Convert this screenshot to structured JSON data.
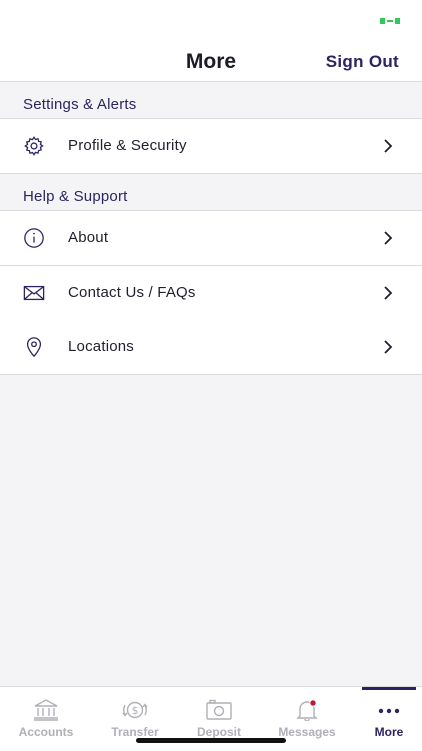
{
  "header": {
    "title": "More",
    "sign_out_label": "Sign Out"
  },
  "sections": [
    {
      "title": "Settings & Alerts",
      "items": [
        {
          "label": "Profile & Security",
          "icon": "gear-icon"
        }
      ]
    },
    {
      "title": "Help & Support",
      "items": [
        {
          "label": "About",
          "icon": "info-icon"
        },
        {
          "label": "Contact Us / FAQs",
          "icon": "envelope-icon"
        },
        {
          "label": "Locations",
          "icon": "location-pin-icon"
        }
      ]
    }
  ],
  "tabs": [
    {
      "label": "Accounts",
      "icon": "bank-icon",
      "active": false
    },
    {
      "label": "Transfer",
      "icon": "money-transfer-icon",
      "active": false
    },
    {
      "label": "Deposit",
      "icon": "camera-icon",
      "active": false
    },
    {
      "label": "Messages",
      "icon": "bell-icon",
      "active": false,
      "badge_color": "#c0182d"
    },
    {
      "label": "More",
      "icon": "more-dots-icon",
      "active": true
    }
  ],
  "colors": {
    "accent": "#2a2560",
    "battery": "#34c759",
    "inactive_tab": "#b0b0b6",
    "background": "#f4f4f6"
  }
}
